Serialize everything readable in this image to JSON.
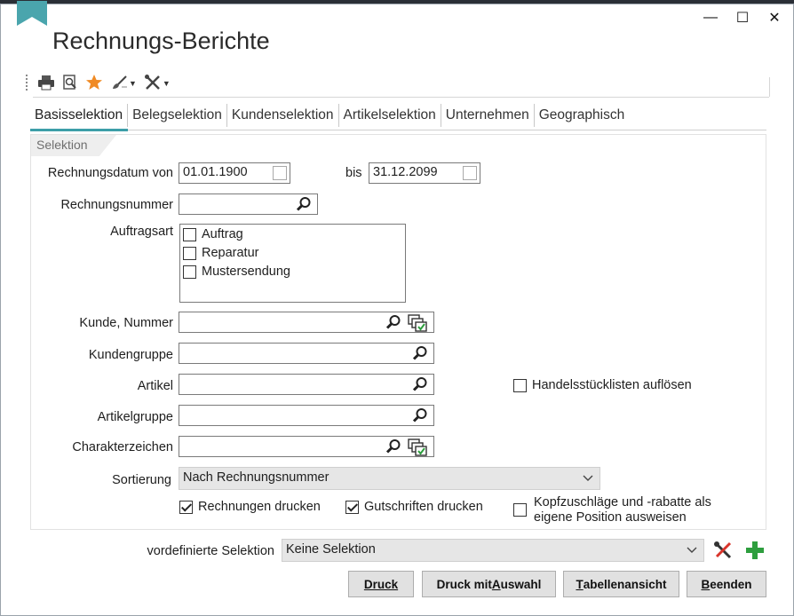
{
  "window": {
    "title": "Rechnungs-Berichte",
    "controls": {
      "minimize": "—",
      "maximize": "☐",
      "close": "✕"
    }
  },
  "toolbar": {
    "items": [
      "printer-icon",
      "print-preview-icon",
      "favorite-star-icon",
      "brush-icon",
      "tools-icon"
    ]
  },
  "tabs": [
    "Basisselektion",
    "Belegselektion",
    "Kundenselektion",
    "Artikelselektion",
    "Unternehmen",
    "Geographisch"
  ],
  "active_tab": "Basisselektion",
  "group": {
    "label": "Selektion"
  },
  "form": {
    "rechnungsdatum_label": "Rechnungsdatum von",
    "date_from": "01.01.1900",
    "bis_label": "bis",
    "date_to": "31.12.2099",
    "rechnungsnummer_label": "Rechnungsnummer",
    "rechnungsnummer_value": "",
    "auftragsart_label": "Auftragsart",
    "auftragsart_options": [
      {
        "label": "Auftrag",
        "checked": false
      },
      {
        "label": "Reparatur",
        "checked": false
      },
      {
        "label": "Mustersendung",
        "checked": false
      }
    ],
    "kunde_label": "Kunde, Nummer",
    "kunde_value": "",
    "kundengruppe_label": "Kundengruppe",
    "kundengruppe_value": "",
    "artikel_label": "Artikel",
    "artikel_value": "",
    "handelsstueck_label": "Handelsstücklisten auflösen",
    "handelsstueck_checked": false,
    "artikelgruppe_label": "Artikelgruppe",
    "artikelgruppe_value": "",
    "charakter_label": "Charakterzeichen",
    "charakter_value": "",
    "sortierung_label": "Sortierung",
    "sortierung_value": "Nach Rechnungsnummer",
    "rechnungen_drucken_label": "Rechnungen drucken",
    "rechnungen_drucken_checked": true,
    "gutschriften_drucken_label": "Gutschriften drucken",
    "gutschriften_drucken_checked": true,
    "kopf_label_line1": "Kopfzuschläge und -rabatte als",
    "kopf_label_line2": "eigene Position ausweisen",
    "kopf_checked": false
  },
  "footer": {
    "vordefinierte_label": "vordefinierte Selektion",
    "vordefinierte_value": "Keine Selektion",
    "buttons": {
      "druck": "Druck",
      "druck_auswahl_pre": "Druck mit ",
      "druck_auswahl_u": "A",
      "druck_auswahl_post": "uswahl",
      "tabellen_u": "T",
      "tabellen_post": "abellenansicht",
      "beenden_u": "B",
      "beenden_post": "eenden"
    }
  },
  "colors": {
    "accent": "#3d9ea8",
    "bookmark": "#4aa5ad",
    "add_green": "#2e9e3e",
    "star": "#f08a24"
  }
}
